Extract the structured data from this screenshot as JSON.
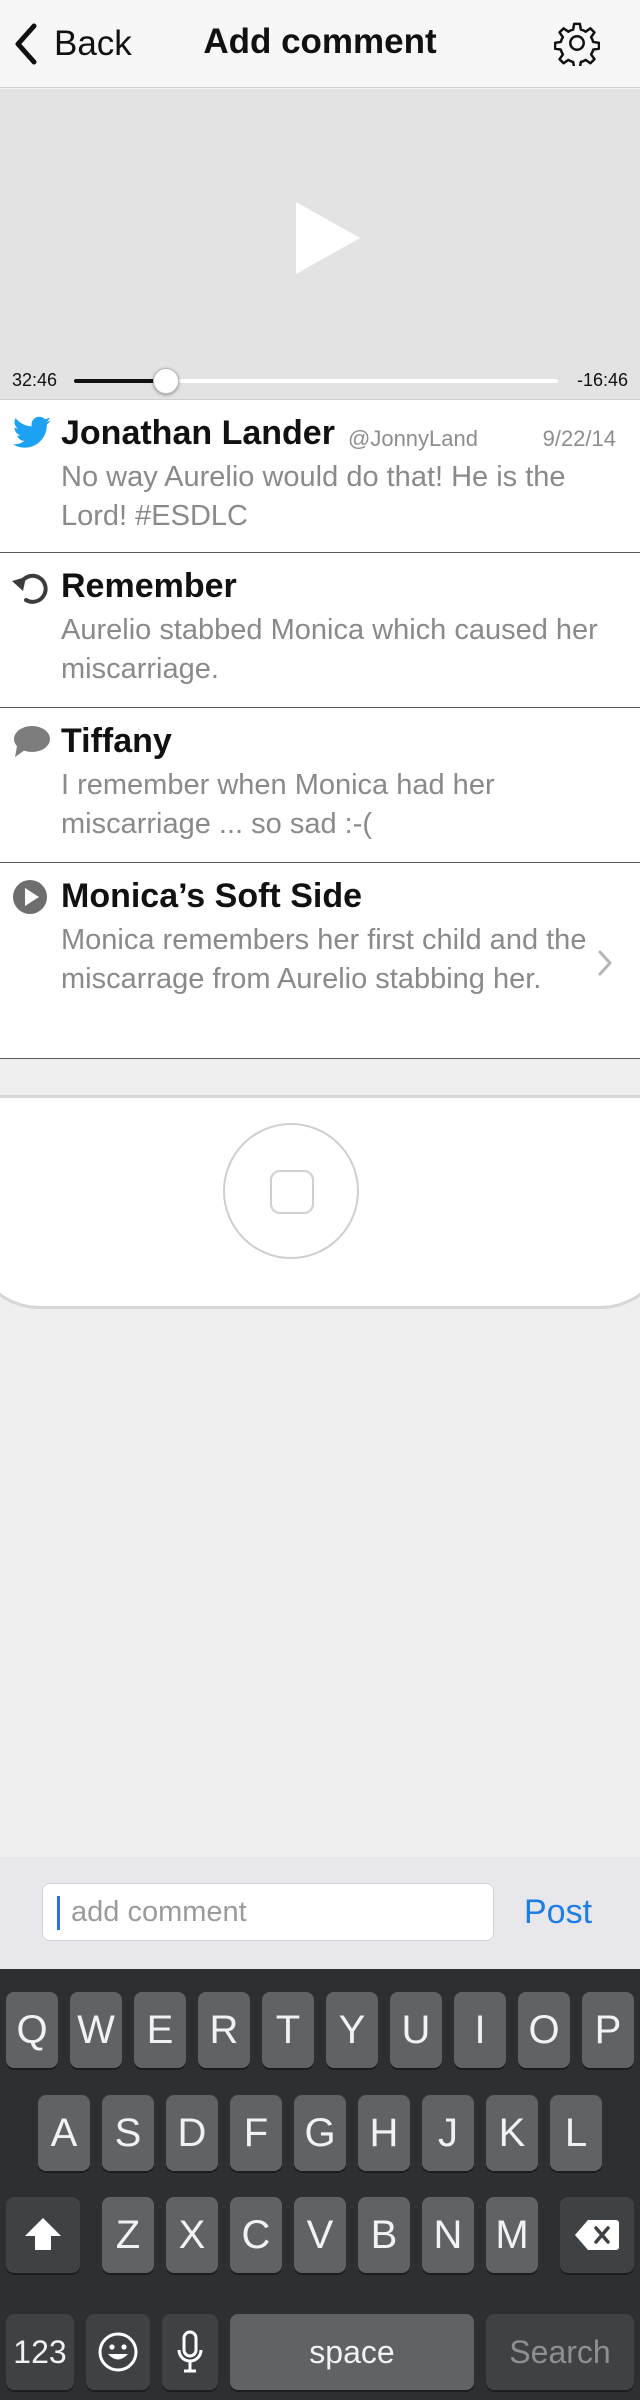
{
  "nav": {
    "back_label": "Back",
    "title": "Add comment",
    "back_icon": "chevron-left-icon",
    "settings_icon": "gear-icon"
  },
  "player": {
    "elapsed": "32:46",
    "remaining": "-16:46",
    "progress_fraction": 0.19,
    "play_icon": "play-icon"
  },
  "comments": [
    {
      "type": "tweet",
      "icon": "twitter-bird-icon",
      "icon_color": "#1da1f2",
      "title": "Jonathan Lander",
      "handle": "@JonnyLand",
      "date": "9/22/14",
      "body": "No way Aurelio would do that! He is the Lord! #ESDLC"
    },
    {
      "type": "remember",
      "icon": "undo-arrow-icon",
      "title": "Remember",
      "body": "Aurelio stabbed Monica which caused her miscarriage."
    },
    {
      "type": "comment",
      "icon": "speech-bubble-icon",
      "title": "Tiffany",
      "body": "I remember when Monica had her miscarriage ... so sad :-("
    },
    {
      "type": "video",
      "icon": "play-circle-icon",
      "title": "Monica’s Soft Side",
      "body": "Monica remembers her first child and the miscarrage from Aurelio stabbing her.",
      "chevron": "chevron-right-icon"
    }
  ],
  "comment_bar": {
    "placeholder": "add comment",
    "value": "",
    "post_label": "Post"
  },
  "keyboard": {
    "row1": [
      "Q",
      "W",
      "E",
      "R",
      "T",
      "Y",
      "U",
      "I",
      "O",
      "P"
    ],
    "row2": [
      "A",
      "S",
      "D",
      "F",
      "G",
      "H",
      "J",
      "K",
      "L"
    ],
    "row3": [
      "Z",
      "X",
      "C",
      "V",
      "B",
      "N",
      "M"
    ],
    "numbers_label": "123",
    "space_label": "space",
    "search_label": "Search",
    "shift_icon": "shift-arrow-icon",
    "delete_icon": "backspace-icon",
    "emoji_icon": "emoji-icon",
    "mic_icon": "microphone-icon"
  }
}
